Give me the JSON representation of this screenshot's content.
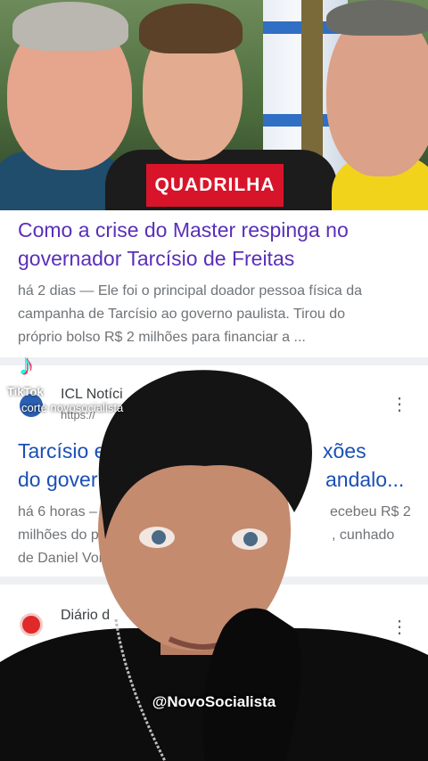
{
  "badge": "QUADRILHA",
  "article1": {
    "title_line1": "Como a crise do Master respinga no",
    "title_line2": "governador Tarcísio de Freitas",
    "snippet_line1": "há 2 dias — Ele foi o principal doador pessoa física da",
    "snippet_line2": "campanha de Tarcísio ao governo paulista. Tirou do",
    "snippet_line3": "próprio bolso R$ 2 milhões para financiar a ..."
  },
  "article2": {
    "source": "ICL Notíci",
    "url": "https://",
    "title_line1_a": "Tarcísio e",
    "title_line1_b": "xões",
    "title_line2_a": "do gover",
    "title_line2_b": "andalo...",
    "snippet_line1_a": "há 6 horas –",
    "snippet_line1_b": "ecebeu R$ 2",
    "snippet_line2_a": "milhões do p",
    "snippet_line2_b": ", cunhado",
    "snippet_line3": "de Daniel Vorc"
  },
  "article3": {
    "source": "Diário d"
  },
  "tiktok": {
    "brand": "TikTok",
    "user": "corte  novosocialista"
  },
  "watermark": "@NovoSocialista",
  "colors": {
    "badge": "#d8142a",
    "headline": "#5a2fb8",
    "article2_headline": "#1a4fb5"
  }
}
